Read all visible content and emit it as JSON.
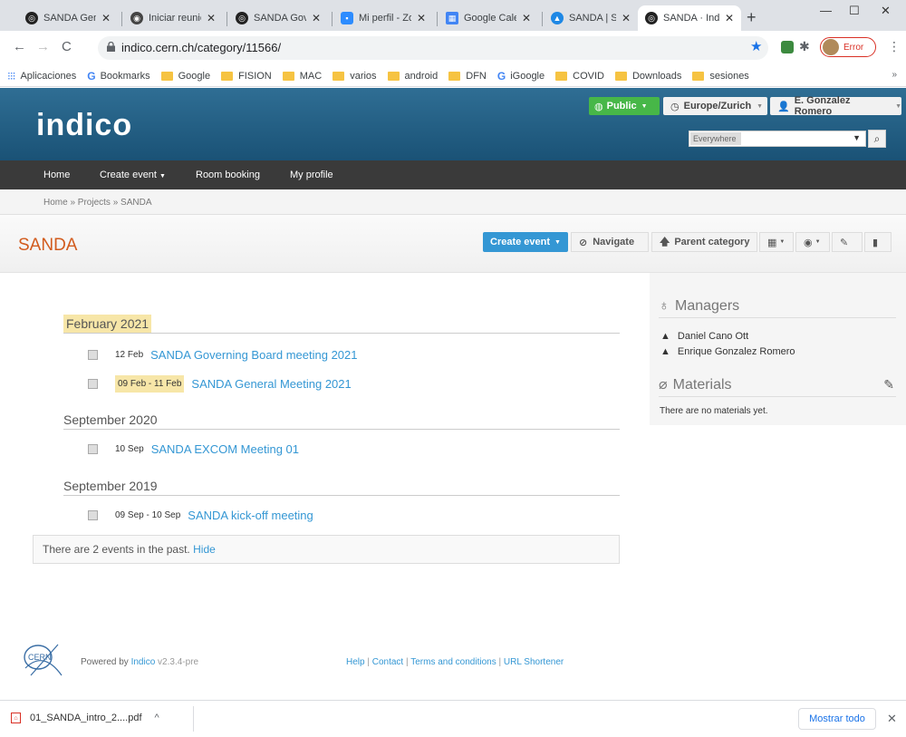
{
  "browser": {
    "tabs": [
      {
        "label": "SANDA Gene",
        "active": false
      },
      {
        "label": "Iniciar reunió",
        "active": false
      },
      {
        "label": "SANDA Gove",
        "active": false
      },
      {
        "label": "Mi perfil - Zo",
        "active": false
      },
      {
        "label": "Google Caler",
        "active": false
      },
      {
        "label": "SANDA | SAN",
        "active": false
      },
      {
        "label": "SANDA · Indi",
        "active": true
      }
    ],
    "url": "indico.cern.ch/category/11566/",
    "profile_status": "Error",
    "bookmarks": [
      {
        "label": "Aplicaciones",
        "icon": "apps-icon"
      },
      {
        "label": "Bookmarks",
        "icon": "google-icon"
      },
      {
        "label": "Google",
        "icon": "folder-icon"
      },
      {
        "label": "FISION",
        "icon": "folder-icon"
      },
      {
        "label": "MAC",
        "icon": "folder-icon"
      },
      {
        "label": "varios",
        "icon": "folder-icon"
      },
      {
        "label": "android",
        "icon": "folder-icon"
      },
      {
        "label": "DFN",
        "icon": "folder-icon"
      },
      {
        "label": "iGoogle",
        "icon": "google-icon"
      },
      {
        "label": "COVID",
        "icon": "folder-icon"
      },
      {
        "label": "Downloads",
        "icon": "folder-icon"
      },
      {
        "label": "sesiones",
        "icon": "folder-icon"
      }
    ],
    "bookmarks_more": "»"
  },
  "indico": {
    "logo": "indico",
    "public_label": "Public",
    "timezone_label": "Europe/Zurich",
    "user_label": "E. Gonzalez Romero",
    "search_scope": "Everywhere",
    "nav": {
      "home": "Home",
      "create_event": "Create event",
      "room_booking": "Room booking",
      "my_profile": "My profile"
    },
    "breadcrumb": "Home  »  Projects  »  SANDA",
    "category_title": "SANDA",
    "toolbar": {
      "create_event": "Create event",
      "navigate": "Navigate",
      "parent_category": "Parent category"
    }
  },
  "events": {
    "groups": [
      {
        "month": "February 2021",
        "highlight": true,
        "items": [
          {
            "date": "12 Feb",
            "title": "SANDA Governing Board meeting 2021",
            "highlight": false
          },
          {
            "date": "09 Feb - 11 Feb",
            "title": "SANDA General Meeting 2021",
            "highlight": true
          }
        ]
      },
      {
        "month": "September 2020",
        "highlight": false,
        "items": [
          {
            "date": "10 Sep",
            "title": "SANDA EXCOM Meeting 01",
            "highlight": false
          }
        ]
      },
      {
        "month": "September 2019",
        "highlight": false,
        "items": [
          {
            "date": "09 Sep - 10 Sep",
            "title": "SANDA kick-off meeting",
            "highlight": false
          }
        ]
      }
    ],
    "past_text": "There are 2 events in the past.",
    "past_hide": "Hide"
  },
  "sidebar": {
    "managers_title": "Managers",
    "managers": [
      "Daniel Cano Ott",
      "Enrique Gonzalez Romero"
    ],
    "materials_title": "Materials",
    "materials_empty": "There are no materials yet."
  },
  "footer": {
    "cern_logo": "CERN",
    "powered_by": "Powered by ",
    "indico_link": "Indico",
    "version": " v2.3.4-pre",
    "help": "Help",
    "contact": "Contact",
    "terms": "Terms and conditions",
    "url_shortener": "URL Shortener"
  },
  "downloads": {
    "file": "01_SANDA_intro_2....pdf",
    "show_all": "Mostrar todo"
  }
}
